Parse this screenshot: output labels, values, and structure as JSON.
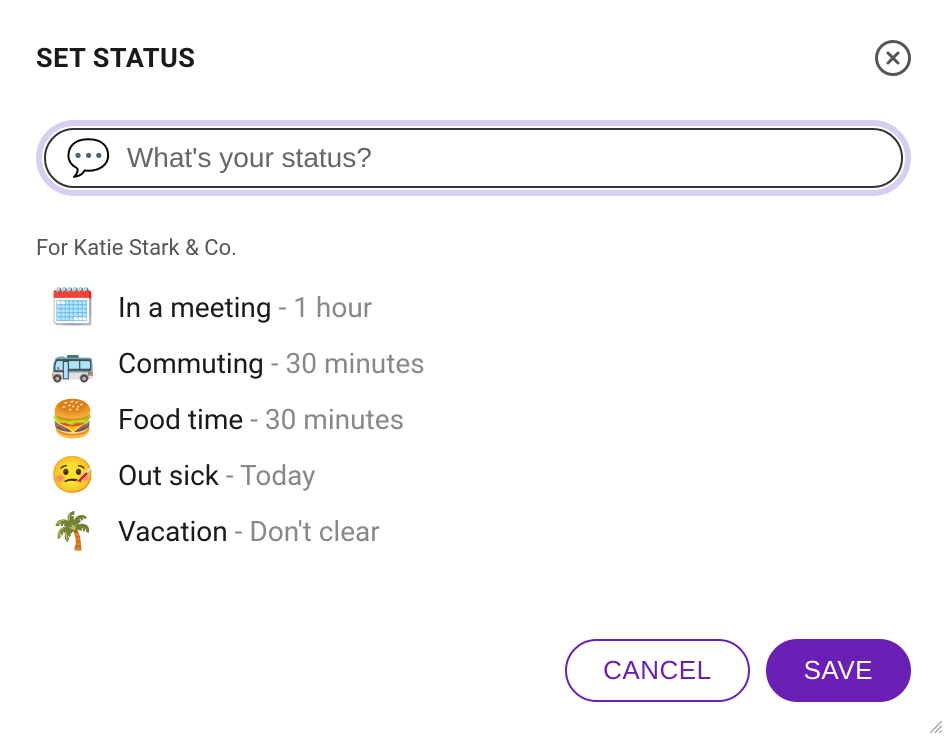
{
  "header": {
    "title": "SET STATUS"
  },
  "input": {
    "emoji": "💬",
    "placeholder": "What's your status?",
    "value": ""
  },
  "subtitle": "For Katie Stark & Co.",
  "options": [
    {
      "emoji": "🗓️",
      "label": "In a meeting",
      "duration": "1 hour"
    },
    {
      "emoji": "🚌",
      "label": "Commuting",
      "duration": "30 minutes"
    },
    {
      "emoji": "🍔",
      "label": "Food time",
      "duration": "30 minutes"
    },
    {
      "emoji": "🤒",
      "label": "Out sick",
      "duration": "Today"
    },
    {
      "emoji": "🌴",
      "label": "Vacation",
      "duration": "Don't clear"
    }
  ],
  "footer": {
    "cancel": "CANCEL",
    "save": "SAVE"
  }
}
